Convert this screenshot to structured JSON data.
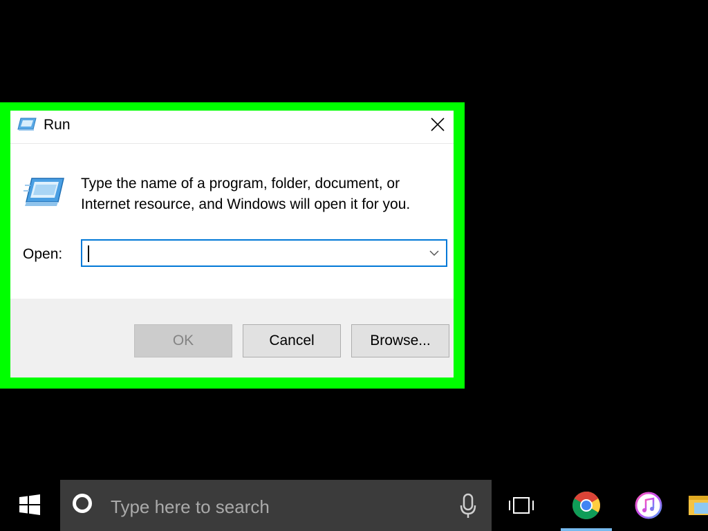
{
  "dialog": {
    "title": "Run",
    "description_line1": "Type the name of a program, folder, document, or",
    "description_line2": "Internet resource, and Windows will open it for you.",
    "open_label": "Open:",
    "open_value": "",
    "buttons": {
      "ok": "OK",
      "cancel": "Cancel",
      "browse": "Browse..."
    },
    "close_icon": "close-icon",
    "dropdown_icon": "chevron-down-icon"
  },
  "taskbar": {
    "search_placeholder": "Type here to search",
    "start_icon": "windows-logo-icon",
    "cortana_icon": "cortana-icon",
    "mic_icon": "microphone-icon",
    "taskview_icon": "task-view-icon",
    "apps": [
      {
        "name": "chrome-icon",
        "active": true
      },
      {
        "name": "itunes-icon",
        "active": false
      },
      {
        "name": "file-explorer-icon",
        "active": false
      }
    ]
  },
  "colors": {
    "highlight": "#00ff00",
    "focus_border": "#0078d7",
    "taskbar_search_bg": "#3b3b3b",
    "active_indicator": "#76b9ed"
  }
}
